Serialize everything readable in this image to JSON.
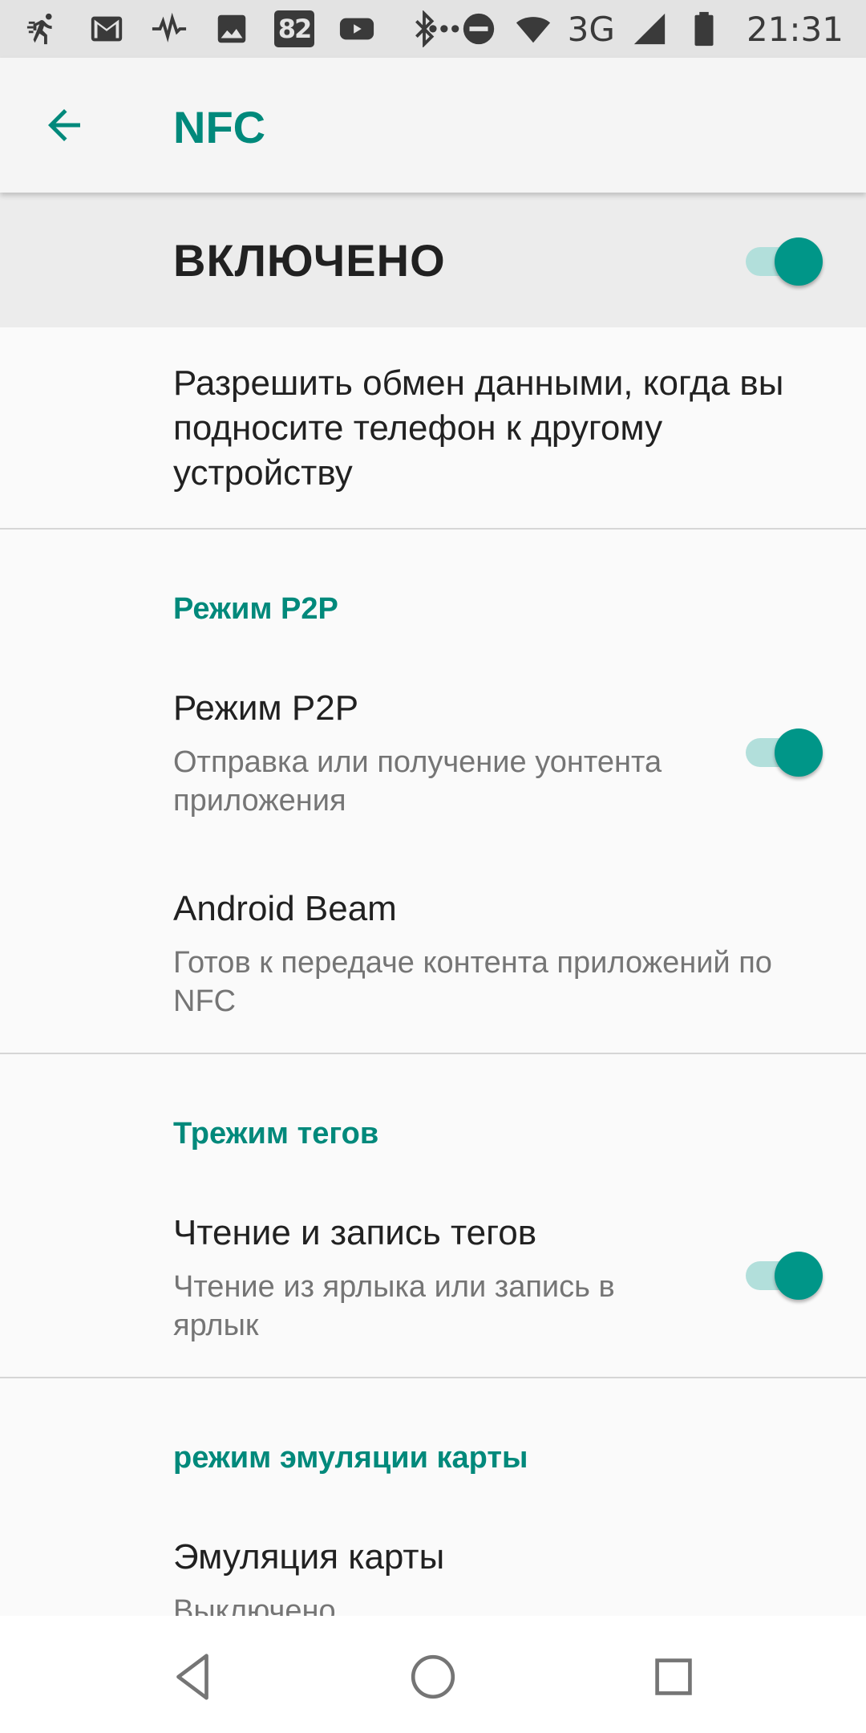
{
  "status_bar": {
    "notification_icons": [
      "runner-icon",
      "gmail-icon",
      "pulse-icon",
      "image-icon"
    ],
    "badge_text": "82",
    "more_dots": "•••",
    "network_type": "3G",
    "time": "21:31"
  },
  "app_bar": {
    "title": "NFC"
  },
  "master_switch": {
    "label": "ВКЛЮЧЕНО",
    "on": true
  },
  "description": "Разрешить обмен данными, когда вы подносите телефон к другому устройству",
  "sections": [
    {
      "header": "Режим P2P",
      "items": [
        {
          "title": "Режим P2P",
          "subtitle": "Отправка или получение уонтента приложения",
          "switch_on": true
        },
        {
          "title": "Android Beam",
          "subtitle": "Готов к передаче контента приложений по NFC"
        }
      ]
    },
    {
      "header": "Трежим тегов",
      "items": [
        {
          "title": "Чтение и запись тегов",
          "subtitle": "Чтение из ярлыка или запись в ярлык",
          "switch_on": true
        }
      ]
    },
    {
      "header": "режим эмуляции карты",
      "items": [
        {
          "title": "Эмуляция карты",
          "subtitle": "Выключено"
        }
      ]
    }
  ],
  "colors": {
    "accent": "#00897b",
    "switch_thumb": "#009688",
    "switch_track": "#b2dfdb",
    "status_bar": "#e3e3e3"
  }
}
